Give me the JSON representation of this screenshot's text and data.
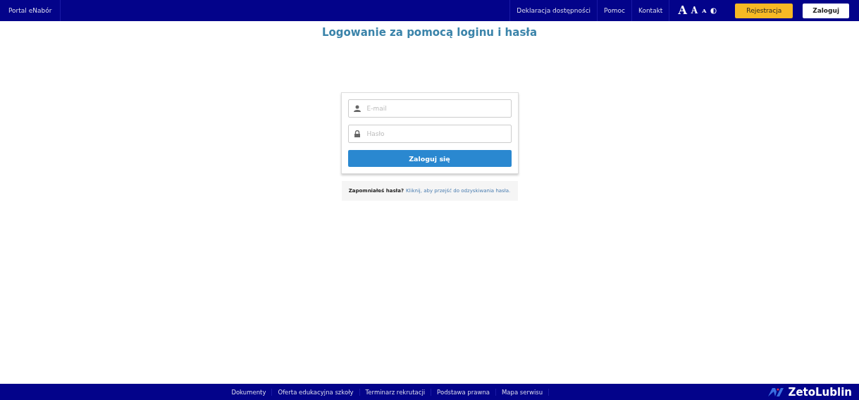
{
  "header": {
    "brand": "Portal eNabór",
    "links": [
      "Deklaracja dostępności",
      "Pomoc",
      "Kontakt"
    ],
    "font_sizes": [
      "A",
      "A",
      "A"
    ],
    "register_button": "Rejestracja",
    "login_button": "Zaloguj"
  },
  "title": "Logowanie za pomocą loginu i hasła",
  "login_form": {
    "email": {
      "placeholder": "E-mail"
    },
    "password": {
      "placeholder": "Hasło"
    },
    "submit": "Zaloguj się"
  },
  "forgot": {
    "text": "Zapomniałeś hasła?",
    "link": "Kliknij, aby przejść do odzyskiwania hasła."
  },
  "footer": {
    "links": [
      "Dokumenty",
      "Oferta edukacyjna szkoły",
      "Terminarz rekrutacji",
      "Podstawa prawna",
      "Mapa serwisu"
    ],
    "logo": "ZetoLublin"
  }
}
